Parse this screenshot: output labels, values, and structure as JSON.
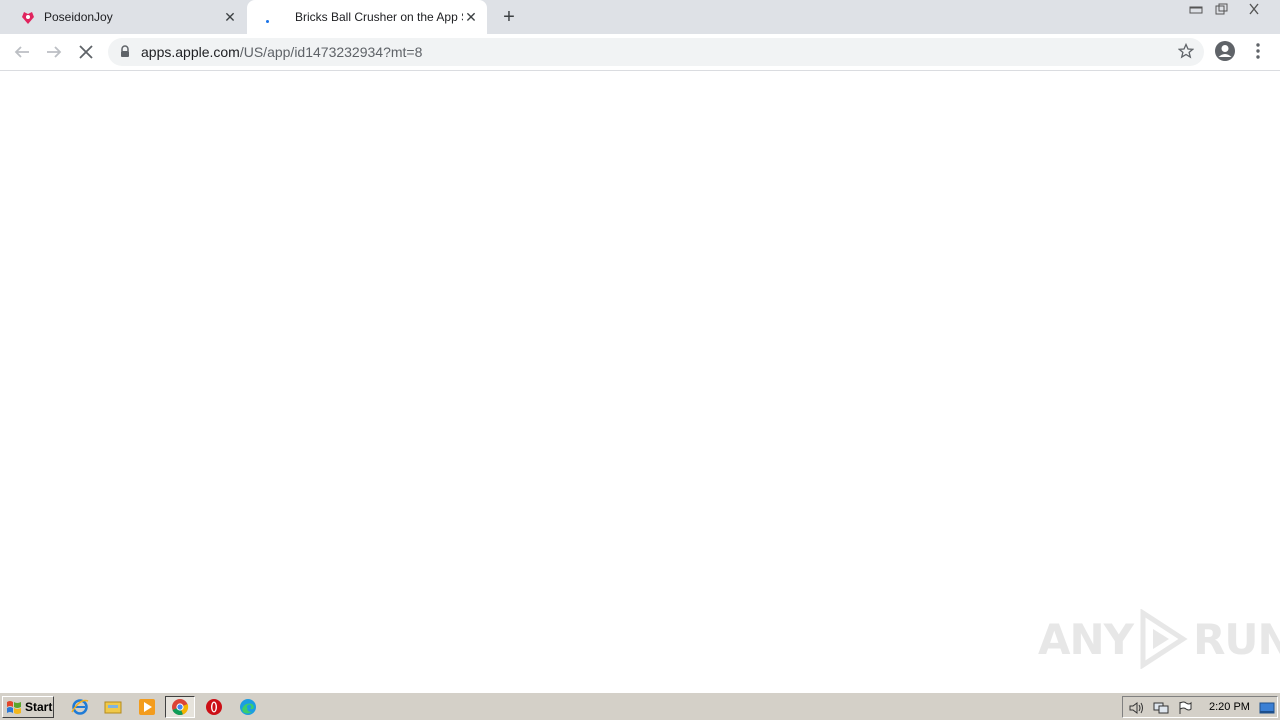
{
  "tabs": [
    {
      "title": "PoseidonJoy",
      "state": "inactive",
      "favicon": "poseidonjoy-logo-icon"
    },
    {
      "title": "Bricks Ball Crusher on the App Store",
      "state": "active-loading",
      "favicon": "loading-spinner-icon"
    }
  ],
  "toolbar": {
    "url_host": "apps.apple.com",
    "url_path": "/US/app/id1473232934?mt=8"
  },
  "watermark": {
    "text_left": "ANY",
    "text_right": "RUN"
  },
  "taskbar": {
    "start_label": "Start",
    "pinned": [
      "internet-explorer-icon",
      "file-explorer-icon",
      "media-player-icon",
      "chrome-icon",
      "opera-icon",
      "edge-icon"
    ],
    "clock": "2:20 PM"
  },
  "colors": {
    "tabstrip": "#dee1e6",
    "omnibox": "#f1f3f4",
    "taskbar": "#d4d0c8",
    "accent": "#1a73e8"
  }
}
